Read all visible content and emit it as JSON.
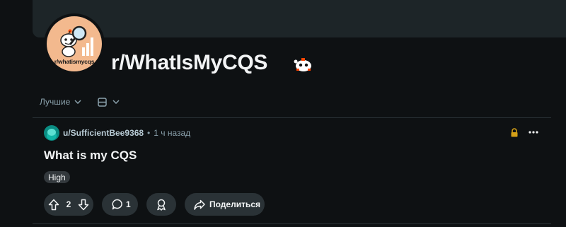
{
  "subreddit": {
    "name": "r/WhatIsMyCQS",
    "avatar_text": "r/whatismycqs"
  },
  "feed_controls": {
    "sort_label": "Лучшие",
    "sort_icon": "chevron-down-icon",
    "view_icon": "layout-card-icon"
  },
  "post": {
    "author": "u/SufficientBee9368",
    "separator": "•",
    "time": "1 ч назад",
    "title": "What is my CQS",
    "flair": "High",
    "locked": true,
    "votes": "2",
    "comments": "1",
    "share_label": "Поделиться"
  },
  "colors": {
    "background": "#0e1113",
    "banner": "#1d2528",
    "pill": "#2a3236",
    "lock": "#d4a017",
    "user_avatar": "#0a8c82"
  }
}
